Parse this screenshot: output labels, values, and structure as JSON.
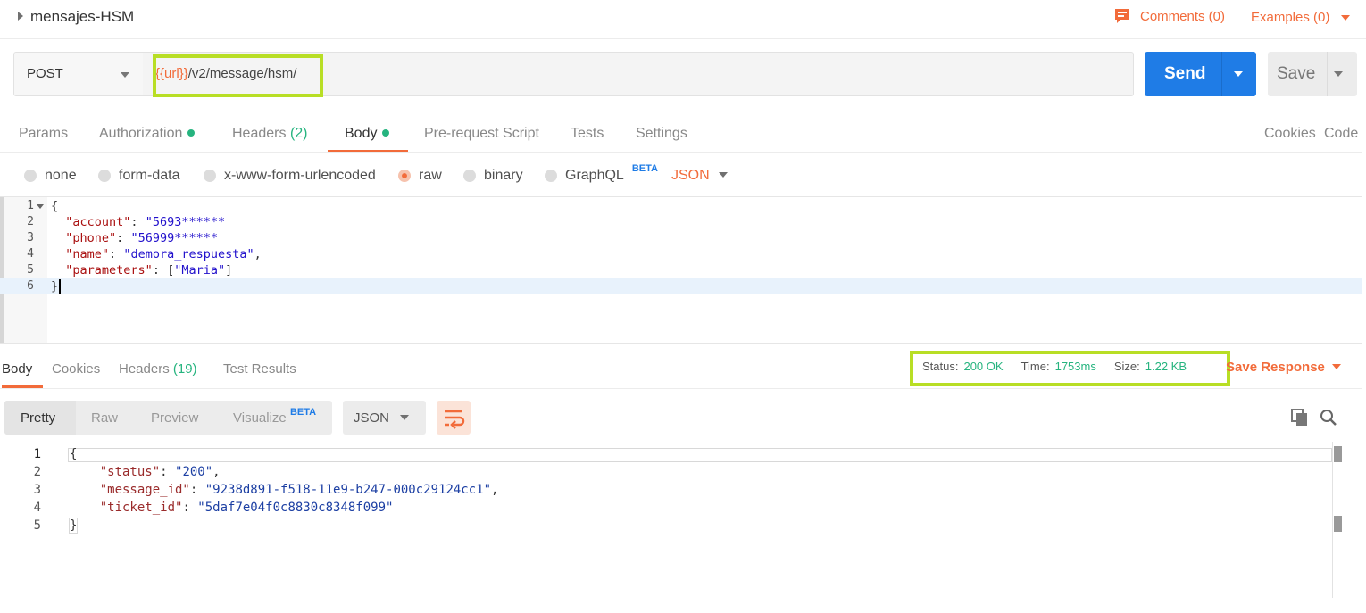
{
  "request": {
    "title": "mensajes-HSM",
    "comments_label": "Comments (0)",
    "examples_label": "Examples (0)",
    "method": "POST",
    "url_var": "{{url}}",
    "url_path": "/v2/message/hsm/",
    "send_label": "Send",
    "save_label": "Save"
  },
  "request_tabs": {
    "params": "Params",
    "authorization": "Authorization",
    "headers": "Headers",
    "headers_count": "(2)",
    "body": "Body",
    "prerequest": "Pre-request Script",
    "tests": "Tests",
    "settings": "Settings",
    "cookies": "Cookies",
    "code": "Code"
  },
  "body_types": {
    "none": "none",
    "form_data": "form-data",
    "urlencoded": "x-www-form-urlencoded",
    "raw": "raw",
    "binary": "binary",
    "graphql": "GraphQL",
    "beta": "BETA",
    "format": "JSON",
    "selected": "raw"
  },
  "editor": {
    "line_numbers": [
      "1",
      "2",
      "3",
      "4",
      "5",
      "6"
    ],
    "lines": {
      "l1": "{",
      "account_key": "\"account\"",
      "account_val": "\"5693******",
      "phone_key": "\"phone\"",
      "phone_val": "\"56999******",
      "name_key": "\"name\"",
      "name_val": "\"demora_respuesta\"",
      "params_key": "\"parameters\"",
      "params_val": "\"Maria\"",
      "l6": "}"
    }
  },
  "response_tabs": {
    "body": "Body",
    "cookies": "Cookies",
    "headers": "Headers",
    "headers_count": "(19)",
    "test_results": "Test Results"
  },
  "response_meta": {
    "status_label": "Status:",
    "status_value": "200 OK",
    "time_label": "Time:",
    "time_value": "1753ms",
    "size_label": "Size:",
    "size_value": "1.22 KB",
    "save_response": "Save Response"
  },
  "response_toolbar": {
    "pretty": "Pretty",
    "raw": "Raw",
    "preview": "Preview",
    "visualize": "Visualize",
    "beta": "BETA",
    "format": "JSON"
  },
  "response_body": {
    "line_numbers": [
      "1",
      "2",
      "3",
      "4",
      "5"
    ],
    "l1": "{",
    "status_key": "\"status\"",
    "status_val": "\"200\"",
    "message_id_key": "\"message_id\"",
    "message_id_val": "\"9238d891-f518-11e9-b247-000c29124cc1\"",
    "ticket_id_key": "\"ticket_id\"",
    "ticket_id_val": "\"5daf7e04f0c8830c8348f099\"",
    "l5": "}"
  },
  "colors": {
    "accent": "#f26b3a",
    "send": "#1f7ce6",
    "status_ok": "#26b47f",
    "highlight_box": "#b8de25"
  }
}
